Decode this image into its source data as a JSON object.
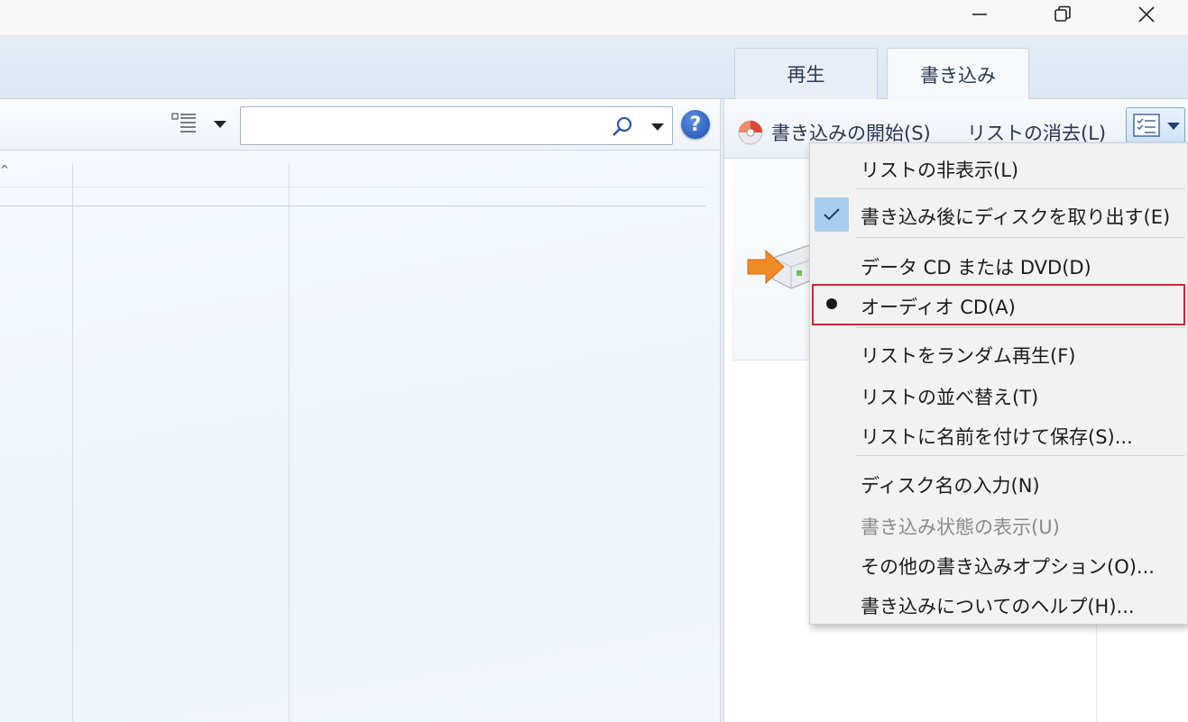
{
  "window": {
    "controls": {
      "minimize": "minimize",
      "maximize": "restore",
      "close": "close"
    }
  },
  "tabs": [
    {
      "label": "再生",
      "active": false
    },
    {
      "label": "書き込み",
      "active": true
    }
  ],
  "library": {
    "search": {
      "value": "",
      "placeholder": ""
    },
    "help_label": "?",
    "sort_indicator": "^"
  },
  "burn_toolbar": {
    "start_burn_label": "書き込みの開始(S)",
    "clear_list_label": "リストの消去(L)"
  },
  "burn_menu": {
    "items": [
      {
        "label": "リストの非表示(L)",
        "state": "normal"
      },
      {
        "label": "書き込み後にディスクを取り出す(E)",
        "state": "checked"
      },
      {
        "label": "データ CD または DVD(D)",
        "state": "normal"
      },
      {
        "label": "オーディオ CD(A)",
        "state": "selected-radio",
        "highlighted": true
      },
      {
        "label": "リストをランダム再生(F)",
        "state": "normal"
      },
      {
        "label": "リストの並べ替え(T)",
        "state": "normal"
      },
      {
        "label": "リストに名前を付けて保存(S)...",
        "state": "normal"
      },
      {
        "label": "ディスク名の入力(N)",
        "state": "normal"
      },
      {
        "label": "書き込み状態の表示(U)",
        "state": "disabled"
      },
      {
        "label": "その他の書き込みオプション(O)...",
        "state": "normal"
      },
      {
        "label": "書き込みについてのヘルプ(H)...",
        "state": "normal"
      }
    ]
  },
  "colors": {
    "highlight_frame": "#d9232e",
    "check_background": "#a9cdf0",
    "drive_arrow": "#f08a24"
  },
  "icons": {
    "view_options": "list-view-icon",
    "search": "magnifier-icon",
    "help": "help-icon",
    "burn": "burn-disc-icon",
    "burn_options": "checklist-options-icon",
    "drive": "optical-drive-icon"
  }
}
